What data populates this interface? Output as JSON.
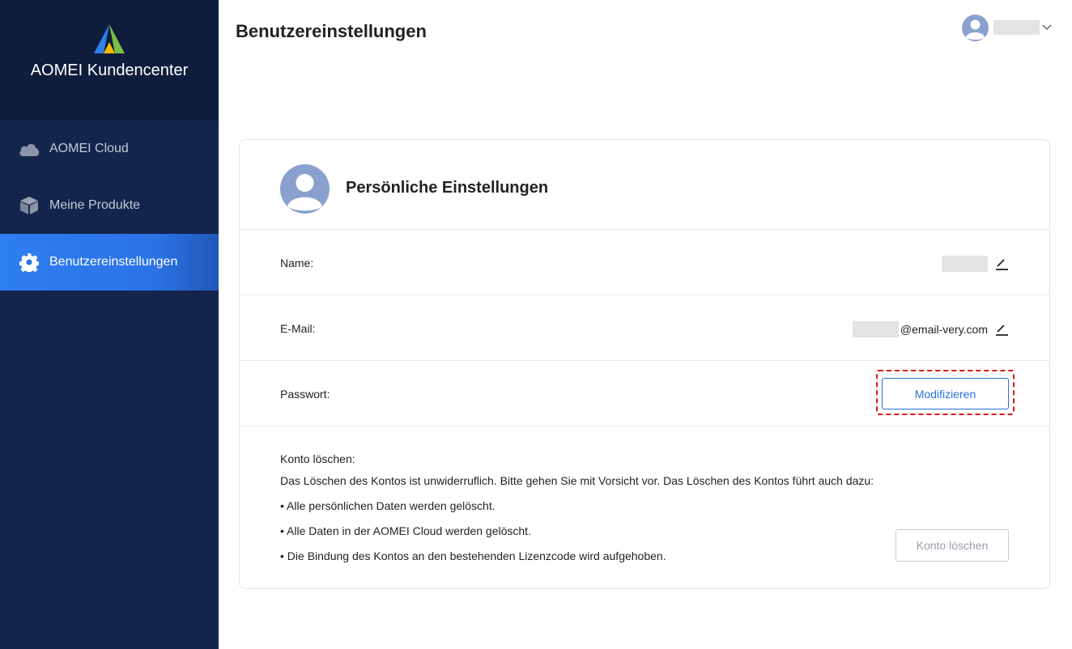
{
  "app": {
    "title": "AOMEI Kundencenter"
  },
  "sidebar": {
    "items": [
      {
        "label": "AOMEI Cloud",
        "icon": "cloud-icon",
        "active": false
      },
      {
        "label": "Meine Produkte",
        "icon": "box-icon",
        "active": false
      },
      {
        "label": "Benutzereinstellungen",
        "icon": "gear-icon",
        "active": true
      }
    ]
  },
  "header": {
    "title": "Benutzereinstellungen",
    "user_icon": "user-avatar-icon",
    "menu_icon": "chevron-down-icon"
  },
  "card": {
    "title": "Persönliche Einstellungen",
    "name": {
      "label": "Name:"
    },
    "email": {
      "label": "E-Mail:",
      "domain": "@email-very.com"
    },
    "password": {
      "label": "Passwort:",
      "button": "Modifizieren"
    },
    "delete": {
      "heading": "Konto löschen:",
      "warning": "Das Löschen des Kontos ist unwiderruflich. Bitte gehen Sie mit Vorsicht vor. Das Löschen des Kontos führt auch dazu:",
      "bullets": [
        "• Alle persönlichen Daten werden gelöscht.",
        "• Alle Daten in der AOMEI Cloud werden gelöscht.",
        "• Die Bindung des Kontos an den bestehenden Lizenzcode wird aufgehoben."
      ],
      "button": "Konto löschen"
    }
  },
  "colors": {
    "sidebar": "#13254c",
    "brand_bg": "#0f1d3d",
    "accent": "#2a6fdb",
    "highlight": "#e0161d"
  }
}
